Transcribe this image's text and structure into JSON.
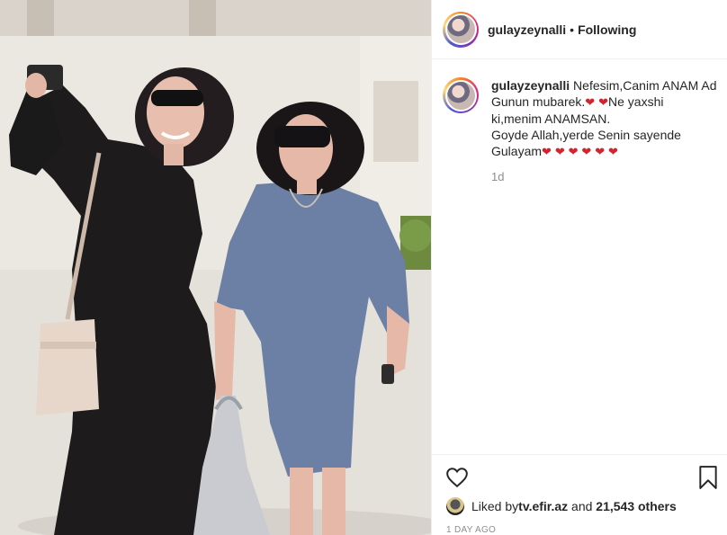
{
  "post": {
    "username": "gulayzeynalli",
    "separator": "•",
    "follow_state": "Following",
    "caption": {
      "username": "gulayzeynalli",
      "line1": " Nefesim,Canim ANAM Ad Gunun mubarek.",
      "line2": "Ne yaxshi ki,menim ANAMSAN.",
      "line3": "Goyde Allah,yerde Senin sayende Gulayam",
      "heart_glyph": "❤",
      "time": "1d"
    },
    "likes": {
      "prefix": "Liked by ",
      "liker": "tv.efir.az",
      "middle": " and ",
      "others": "21,543 others"
    },
    "timestamp": "1 DAY AGO"
  },
  "icons": {
    "like": "heart-outline-icon",
    "save": "bookmark-icon"
  }
}
